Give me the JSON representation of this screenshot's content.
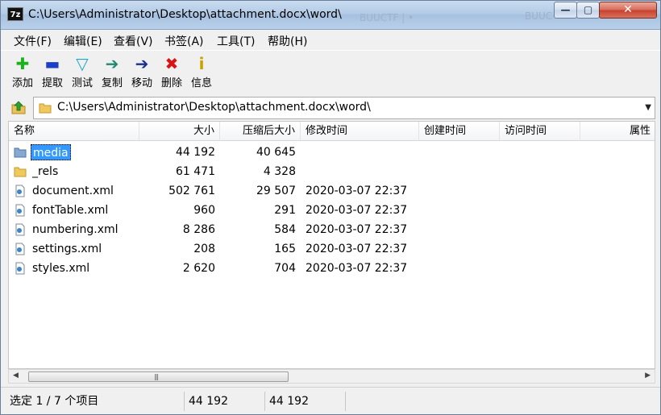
{
  "window": {
    "title": "C:\\Users\\Administrator\\Desktop\\attachment.docx\\word\\",
    "app_icon_text": "7z",
    "minimize_glyph": "—",
    "maximize_glyph": "▢",
    "close_glyph": "✕",
    "background_text_left": "BUUCTF | •",
    "background_text_right": "BUUC"
  },
  "menu": {
    "items": [
      {
        "label": "文件(F)"
      },
      {
        "label": "编辑(E)"
      },
      {
        "label": "查看(V)"
      },
      {
        "label": "书签(A)"
      },
      {
        "label": "工具(T)"
      },
      {
        "label": "帮助(H)"
      }
    ]
  },
  "toolbar": {
    "items": [
      {
        "label": "添加",
        "icon": "add-icon",
        "glyph": "✚",
        "color": "#19b31c"
      },
      {
        "label": "提取",
        "icon": "extract-icon",
        "glyph": "▬",
        "color": "#1c3fc7"
      },
      {
        "label": "测试",
        "icon": "test-icon",
        "glyph": "▽",
        "color": "#1aa9c9"
      },
      {
        "label": "复制",
        "icon": "copy-icon",
        "glyph": "➔",
        "color": "#1d8c6e"
      },
      {
        "label": "移动",
        "icon": "move-icon",
        "glyph": "➔",
        "color": "#1c2f8f"
      },
      {
        "label": "删除",
        "icon": "delete-icon",
        "glyph": "✖",
        "color": "#d81414"
      },
      {
        "label": "信息",
        "icon": "info-icon",
        "glyph": "i",
        "color": "#c9a100"
      }
    ]
  },
  "address": {
    "path": "C:\\Users\\Administrator\\Desktop\\attachment.docx\\word\\",
    "dropdown_glyph": "▼"
  },
  "list": {
    "columns": [
      "名称",
      "大小",
      "压缩后大小",
      "修改时间",
      "创建时间",
      "访问时间",
      "属性"
    ],
    "rows": [
      {
        "name": "media",
        "type": "folder",
        "size": "44 192",
        "packed": "40 645",
        "modified": "",
        "created": "",
        "accessed": "",
        "selected": true
      },
      {
        "name": "_rels",
        "type": "folder",
        "size": "61 471",
        "packed": "4 328",
        "modified": "",
        "created": "",
        "accessed": "",
        "selected": false
      },
      {
        "name": "document.xml",
        "type": "file",
        "size": "502 761",
        "packed": "29 507",
        "modified": "2020-03-07 22:37",
        "created": "",
        "accessed": "",
        "selected": false
      },
      {
        "name": "fontTable.xml",
        "type": "file",
        "size": "960",
        "packed": "291",
        "modified": "2020-03-07 22:37",
        "created": "",
        "accessed": "",
        "selected": false
      },
      {
        "name": "numbering.xml",
        "type": "file",
        "size": "8 286",
        "packed": "584",
        "modified": "2020-03-07 22:37",
        "created": "",
        "accessed": "",
        "selected": false
      },
      {
        "name": "settings.xml",
        "type": "file",
        "size": "208",
        "packed": "165",
        "modified": "2020-03-07 22:37",
        "created": "",
        "accessed": "",
        "selected": false
      },
      {
        "name": "styles.xml",
        "type": "file",
        "size": "2 620",
        "packed": "704",
        "modified": "2020-03-07 22:37",
        "created": "",
        "accessed": "",
        "selected": false
      }
    ]
  },
  "scrollbar": {
    "left_glyph": "◀",
    "right_glyph": "▶",
    "grip": "|||"
  },
  "status": {
    "selection": "选定 1 / 7 个项目",
    "size": "44 192",
    "packed": "44 192"
  }
}
